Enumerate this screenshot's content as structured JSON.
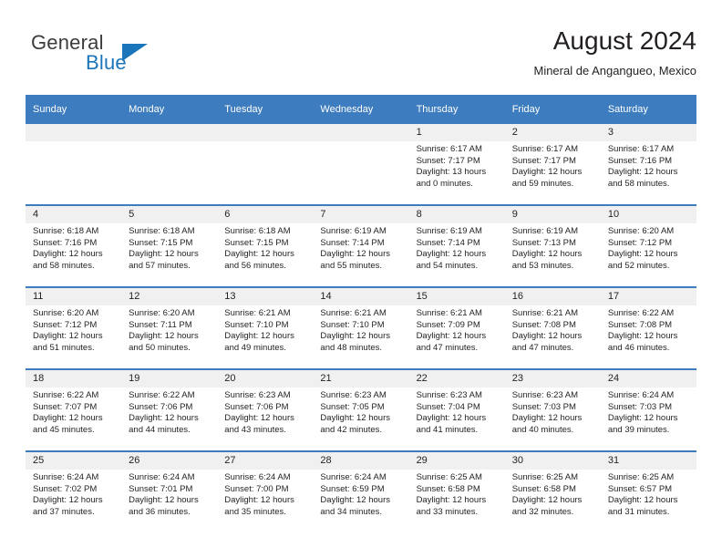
{
  "brand": {
    "line1": "General",
    "line2": "Blue",
    "triangle_color": "#1b75bb"
  },
  "header": {
    "title": "August 2024",
    "subtitle": "Mineral de Angangueo, Mexico",
    "accent_color": "#3d7cbf"
  },
  "calendar": {
    "weekday_headers": [
      "Sunday",
      "Monday",
      "Tuesday",
      "Wednesday",
      "Thursday",
      "Friday",
      "Saturday"
    ],
    "weeks": [
      [
        {
          "day": "",
          "sunrise": "",
          "sunset": "",
          "daylight": ""
        },
        {
          "day": "",
          "sunrise": "",
          "sunset": "",
          "daylight": ""
        },
        {
          "day": "",
          "sunrise": "",
          "sunset": "",
          "daylight": ""
        },
        {
          "day": "",
          "sunrise": "",
          "sunset": "",
          "daylight": ""
        },
        {
          "day": "1",
          "sunrise": "Sunrise: 6:17 AM",
          "sunset": "Sunset: 7:17 PM",
          "daylight": "Daylight: 13 hours and 0 minutes."
        },
        {
          "day": "2",
          "sunrise": "Sunrise: 6:17 AM",
          "sunset": "Sunset: 7:17 PM",
          "daylight": "Daylight: 12 hours and 59 minutes."
        },
        {
          "day": "3",
          "sunrise": "Sunrise: 6:17 AM",
          "sunset": "Sunset: 7:16 PM",
          "daylight": "Daylight: 12 hours and 58 minutes."
        }
      ],
      [
        {
          "day": "4",
          "sunrise": "Sunrise: 6:18 AM",
          "sunset": "Sunset: 7:16 PM",
          "daylight": "Daylight: 12 hours and 58 minutes."
        },
        {
          "day": "5",
          "sunrise": "Sunrise: 6:18 AM",
          "sunset": "Sunset: 7:15 PM",
          "daylight": "Daylight: 12 hours and 57 minutes."
        },
        {
          "day": "6",
          "sunrise": "Sunrise: 6:18 AM",
          "sunset": "Sunset: 7:15 PM",
          "daylight": "Daylight: 12 hours and 56 minutes."
        },
        {
          "day": "7",
          "sunrise": "Sunrise: 6:19 AM",
          "sunset": "Sunset: 7:14 PM",
          "daylight": "Daylight: 12 hours and 55 minutes."
        },
        {
          "day": "8",
          "sunrise": "Sunrise: 6:19 AM",
          "sunset": "Sunset: 7:14 PM",
          "daylight": "Daylight: 12 hours and 54 minutes."
        },
        {
          "day": "9",
          "sunrise": "Sunrise: 6:19 AM",
          "sunset": "Sunset: 7:13 PM",
          "daylight": "Daylight: 12 hours and 53 minutes."
        },
        {
          "day": "10",
          "sunrise": "Sunrise: 6:20 AM",
          "sunset": "Sunset: 7:12 PM",
          "daylight": "Daylight: 12 hours and 52 minutes."
        }
      ],
      [
        {
          "day": "11",
          "sunrise": "Sunrise: 6:20 AM",
          "sunset": "Sunset: 7:12 PM",
          "daylight": "Daylight: 12 hours and 51 minutes."
        },
        {
          "day": "12",
          "sunrise": "Sunrise: 6:20 AM",
          "sunset": "Sunset: 7:11 PM",
          "daylight": "Daylight: 12 hours and 50 minutes."
        },
        {
          "day": "13",
          "sunrise": "Sunrise: 6:21 AM",
          "sunset": "Sunset: 7:10 PM",
          "daylight": "Daylight: 12 hours and 49 minutes."
        },
        {
          "day": "14",
          "sunrise": "Sunrise: 6:21 AM",
          "sunset": "Sunset: 7:10 PM",
          "daylight": "Daylight: 12 hours and 48 minutes."
        },
        {
          "day": "15",
          "sunrise": "Sunrise: 6:21 AM",
          "sunset": "Sunset: 7:09 PM",
          "daylight": "Daylight: 12 hours and 47 minutes."
        },
        {
          "day": "16",
          "sunrise": "Sunrise: 6:21 AM",
          "sunset": "Sunset: 7:08 PM",
          "daylight": "Daylight: 12 hours and 47 minutes."
        },
        {
          "day": "17",
          "sunrise": "Sunrise: 6:22 AM",
          "sunset": "Sunset: 7:08 PM",
          "daylight": "Daylight: 12 hours and 46 minutes."
        }
      ],
      [
        {
          "day": "18",
          "sunrise": "Sunrise: 6:22 AM",
          "sunset": "Sunset: 7:07 PM",
          "daylight": "Daylight: 12 hours and 45 minutes."
        },
        {
          "day": "19",
          "sunrise": "Sunrise: 6:22 AM",
          "sunset": "Sunset: 7:06 PM",
          "daylight": "Daylight: 12 hours and 44 minutes."
        },
        {
          "day": "20",
          "sunrise": "Sunrise: 6:23 AM",
          "sunset": "Sunset: 7:06 PM",
          "daylight": "Daylight: 12 hours and 43 minutes."
        },
        {
          "day": "21",
          "sunrise": "Sunrise: 6:23 AM",
          "sunset": "Sunset: 7:05 PM",
          "daylight": "Daylight: 12 hours and 42 minutes."
        },
        {
          "day": "22",
          "sunrise": "Sunrise: 6:23 AM",
          "sunset": "Sunset: 7:04 PM",
          "daylight": "Daylight: 12 hours and 41 minutes."
        },
        {
          "day": "23",
          "sunrise": "Sunrise: 6:23 AM",
          "sunset": "Sunset: 7:03 PM",
          "daylight": "Daylight: 12 hours and 40 minutes."
        },
        {
          "day": "24",
          "sunrise": "Sunrise: 6:24 AM",
          "sunset": "Sunset: 7:03 PM",
          "daylight": "Daylight: 12 hours and 39 minutes."
        }
      ],
      [
        {
          "day": "25",
          "sunrise": "Sunrise: 6:24 AM",
          "sunset": "Sunset: 7:02 PM",
          "daylight": "Daylight: 12 hours and 37 minutes."
        },
        {
          "day": "26",
          "sunrise": "Sunrise: 6:24 AM",
          "sunset": "Sunset: 7:01 PM",
          "daylight": "Daylight: 12 hours and 36 minutes."
        },
        {
          "day": "27",
          "sunrise": "Sunrise: 6:24 AM",
          "sunset": "Sunset: 7:00 PM",
          "daylight": "Daylight: 12 hours and 35 minutes."
        },
        {
          "day": "28",
          "sunrise": "Sunrise: 6:24 AM",
          "sunset": "Sunset: 6:59 PM",
          "daylight": "Daylight: 12 hours and 34 minutes."
        },
        {
          "day": "29",
          "sunrise": "Sunrise: 6:25 AM",
          "sunset": "Sunset: 6:58 PM",
          "daylight": "Daylight: 12 hours and 33 minutes."
        },
        {
          "day": "30",
          "sunrise": "Sunrise: 6:25 AM",
          "sunset": "Sunset: 6:58 PM",
          "daylight": "Daylight: 12 hours and 32 minutes."
        },
        {
          "day": "31",
          "sunrise": "Sunrise: 6:25 AM",
          "sunset": "Sunset: 6:57 PM",
          "daylight": "Daylight: 12 hours and 31 minutes."
        }
      ]
    ]
  }
}
